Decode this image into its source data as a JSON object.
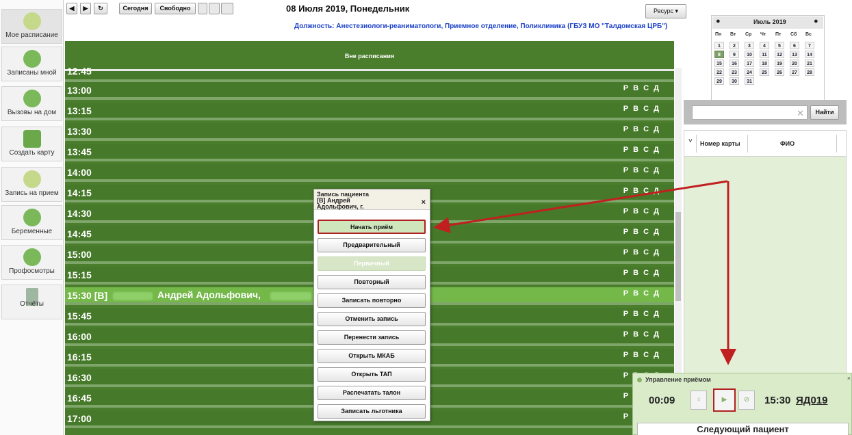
{
  "sidebar": {
    "items": [
      {
        "label": "Мое расписание"
      },
      {
        "label": "Записаны мной"
      },
      {
        "label": "Вызовы на дом"
      },
      {
        "label": "Создать карту"
      },
      {
        "label": "Запись на прием"
      },
      {
        "label": "Беременные"
      },
      {
        "label": "Профосмотры"
      },
      {
        "label": "Отчёты"
      }
    ]
  },
  "toolbar": {
    "prev_icon": "◀",
    "next_icon": "▶",
    "refresh_icon": "↻",
    "today_label": "Сегодня",
    "free_label": "Свободно",
    "date_title": "08 Июля 2019, Понедельник",
    "resource_label": "Ресурс ▾",
    "position": "Должность: Анестезиологи-реаниматологи, Приемное отделение, Поликлиника (ГБУЗ МО \"Талдомская ЦРБ\")"
  },
  "schedule": {
    "header": "Вне расписания",
    "partial_time": "12:45",
    "codes": "Р В С Д",
    "slots": [
      {
        "time": "13:00"
      },
      {
        "time": "13:15"
      },
      {
        "time": "13:30"
      },
      {
        "time": "13:45"
      },
      {
        "time": "14:00"
      },
      {
        "time": "14:15"
      },
      {
        "time": "14:30"
      },
      {
        "time": "14:45"
      },
      {
        "time": "15:00"
      },
      {
        "time": "15:15"
      },
      {
        "time": "15:30 [В]",
        "name": "Андрей Адольфович,",
        "booked": true
      },
      {
        "time": "15:45"
      },
      {
        "time": "16:00"
      },
      {
        "time": "16:15"
      },
      {
        "time": "16:30"
      },
      {
        "time": "16:45"
      },
      {
        "time": "17:00"
      }
    ]
  },
  "popup": {
    "title_line1": "Запись пациента",
    "title_line2": "[В]           Андрей",
    "title_line3": "Адольфович,                г.",
    "close": "×",
    "buttons": [
      {
        "label": "Начать приём",
        "style": "primary"
      },
      {
        "label": "Предварительный"
      },
      {
        "label": "Первичный",
        "style": "disabled"
      },
      {
        "label": "Повторный"
      },
      {
        "label": "Записать повторно"
      },
      {
        "label": "Отменить запись"
      },
      {
        "label": "Перенести запись"
      },
      {
        "label": "Открыть МКАБ"
      },
      {
        "label": "Открыть ТАП"
      },
      {
        "label": "Распечатать талон"
      },
      {
        "label": "Записать льготника"
      }
    ]
  },
  "calendar": {
    "month": "Июль 2019",
    "weekdays": [
      "Пн",
      "Вт",
      "Ср",
      "Чт",
      "Пт",
      "Сб",
      "Вс"
    ],
    "days": [
      [
        "1",
        "2",
        "3",
        "4",
        "5",
        "6",
        "7"
      ],
      [
        "8",
        "9",
        "10",
        "11",
        "12",
        "13",
        "14"
      ],
      [
        "15",
        "16",
        "17",
        "18",
        "19",
        "20",
        "21"
      ],
      [
        "22",
        "23",
        "24",
        "25",
        "26",
        "27",
        "28"
      ],
      [
        "29",
        "30",
        "31"
      ]
    ],
    "selected": "8"
  },
  "search": {
    "button": "Найти",
    "clear": "✕"
  },
  "patients_table": {
    "columns": [
      "Номер карты",
      "ФИО"
    ],
    "sort_icon": "˅"
  },
  "control": {
    "title": "Управление приёмом",
    "timer": "00:09",
    "time": "15:30",
    "code": "ЯД019",
    "next_button": "Следующий пациент",
    "close": "×"
  },
  "colors": {
    "slot": "#467a2a",
    "booked": "#74b84a",
    "arrow": "#c0201f",
    "link": "#1a3fc8"
  }
}
